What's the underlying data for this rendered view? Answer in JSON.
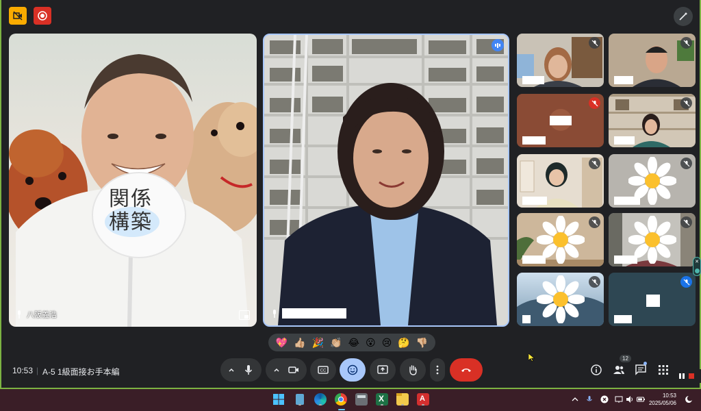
{
  "meeting": {
    "time": "10:53",
    "separator": "|",
    "title": "A-5 1級面接お手本編"
  },
  "participants": {
    "main_left": {
      "name": "八阪義浩",
      "sign_text": "関係構築"
    },
    "main_center": {
      "name": ""
    }
  },
  "reactions": [
    "💖",
    "👍🏼",
    "🎉",
    "👏🏼",
    "😂",
    "😮",
    "😢",
    "🤔",
    "👎🏼"
  ],
  "controls": {
    "people_count": "12"
  },
  "taskbar": {
    "time": "10:53",
    "date": "2025/05/06"
  },
  "colors": {
    "leave": "#d93025",
    "emoji_active": "#a8c7fa",
    "record": "#d93025",
    "record_off": "#f9ab00",
    "frame": "#7cb342"
  }
}
